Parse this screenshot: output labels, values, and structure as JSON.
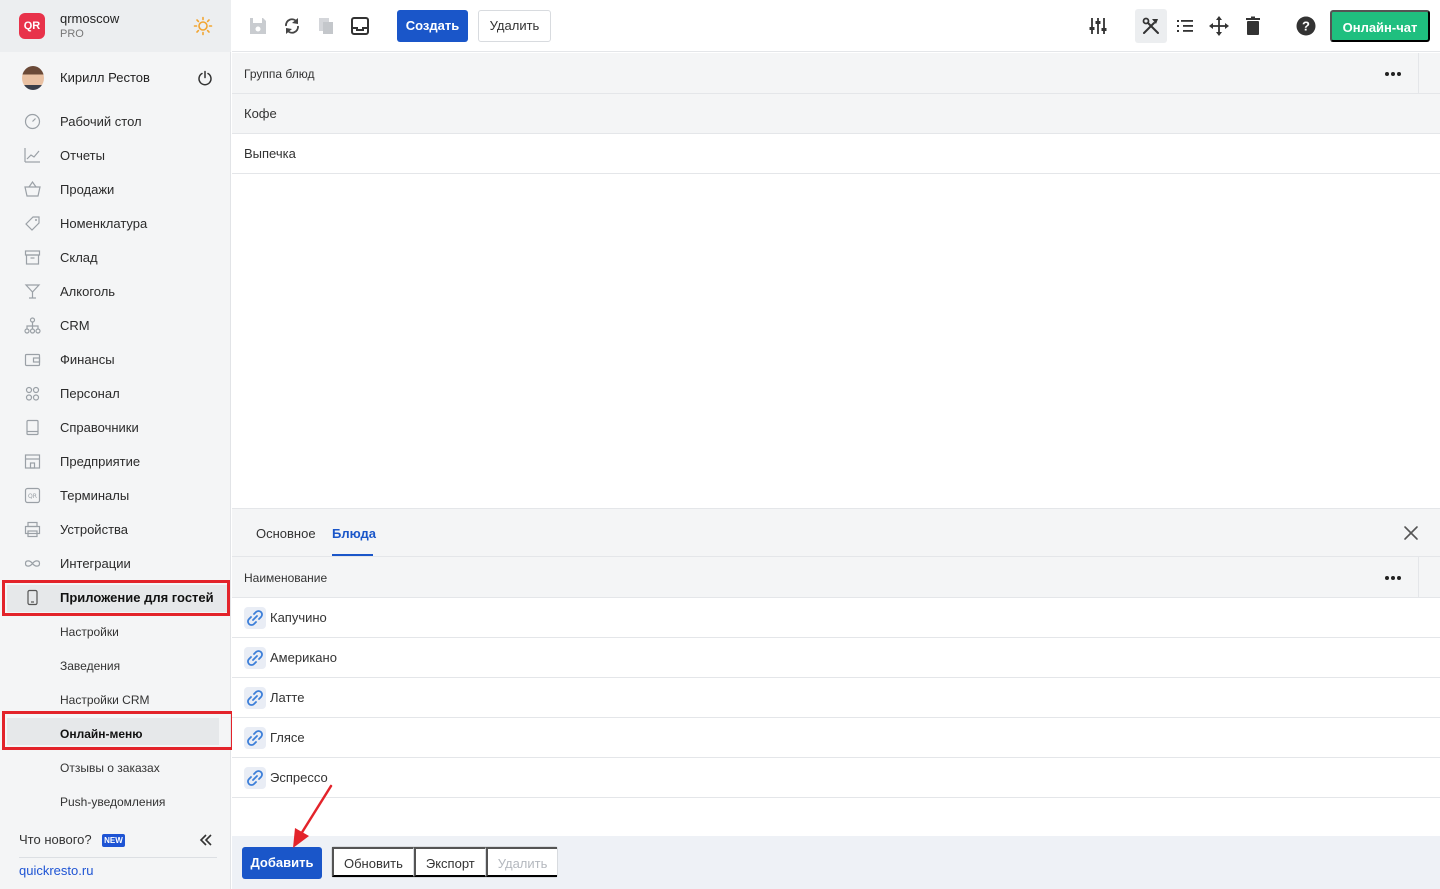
{
  "brand": {
    "logo_text": "QR",
    "name": "qrmoscow",
    "plan": "PRO"
  },
  "user": {
    "name": "Кирилл Рестов"
  },
  "nav": {
    "items": [
      {
        "id": "dashboard",
        "label": "Рабочий стол",
        "icon": "gauge-icon"
      },
      {
        "id": "reports",
        "label": "Отчеты",
        "icon": "chart-icon"
      },
      {
        "id": "sales",
        "label": "Продажи",
        "icon": "basket-icon"
      },
      {
        "id": "nomenclature",
        "label": "Номенклатура",
        "icon": "tag-icon"
      },
      {
        "id": "warehouse",
        "label": "Склад",
        "icon": "box-icon"
      },
      {
        "id": "alcohol",
        "label": "Алкоголь",
        "icon": "glass-icon"
      },
      {
        "id": "crm",
        "label": "CRM",
        "icon": "network-icon"
      },
      {
        "id": "finance",
        "label": "Финансы",
        "icon": "wallet-icon"
      },
      {
        "id": "staff",
        "label": "Персонал",
        "icon": "people-icon"
      },
      {
        "id": "directories",
        "label": "Справочники",
        "icon": "book-icon"
      },
      {
        "id": "enterprise",
        "label": "Предприятие",
        "icon": "building-icon"
      },
      {
        "id": "terminals",
        "label": "Терминалы",
        "icon": "qr-icon"
      },
      {
        "id": "devices",
        "label": "Устройства",
        "icon": "printer-icon"
      },
      {
        "id": "integrations",
        "label": "Интеграции",
        "icon": "infinity-icon"
      },
      {
        "id": "guest-app",
        "label": "Приложение для гостей",
        "icon": "phone-icon"
      }
    ],
    "sub_items": [
      {
        "id": "settings",
        "label": "Настройки"
      },
      {
        "id": "venues",
        "label": "Заведения"
      },
      {
        "id": "crm-settings",
        "label": "Настройки CRM"
      },
      {
        "id": "online-menu",
        "label": "Онлайн-меню"
      },
      {
        "id": "order-reviews",
        "label": "Отзывы о заказах"
      },
      {
        "id": "push",
        "label": "Push-уведомления"
      }
    ],
    "whats_new": "Что нового?",
    "new_badge": "NEW",
    "site": "quickresto.ru"
  },
  "toolbar": {
    "create": "Создать",
    "delete": "Удалить",
    "chat": "Онлайн-чат"
  },
  "groups_grid": {
    "header": "Группа блюд",
    "rows": [
      "Кофе",
      "Выпечка"
    ]
  },
  "detail": {
    "tabs": [
      "Основное",
      "Блюда"
    ],
    "active_tab": "Блюда",
    "header": "Наименование",
    "rows": [
      "Капучино",
      "Американо",
      "Латте",
      "Глясе",
      "Эспрессо"
    ]
  },
  "actions": {
    "add": "Добавить",
    "refresh": "Обновить",
    "export": "Экспорт",
    "delete": "Удалить"
  },
  "colors": {
    "primary": "#1a56c9",
    "chat": "#1fbf7f",
    "highlight": "#e3232a",
    "brand": "#e8324a"
  }
}
